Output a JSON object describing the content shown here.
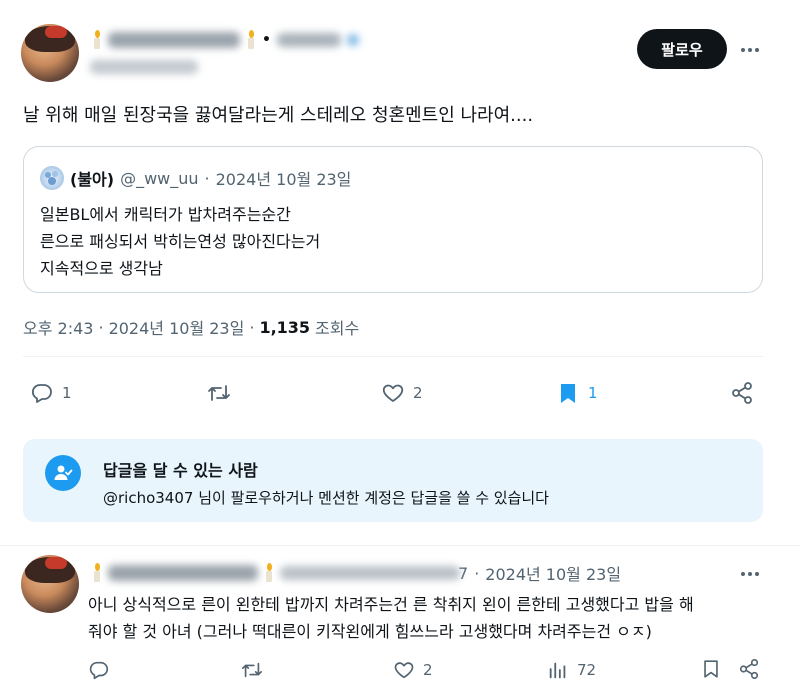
{
  "main_post": {
    "follow_label": "팔로우",
    "more_label": "···",
    "text": "날 위해 매일 된장국을 끓여달라는게 스테레오 청혼멘트인 나라여....",
    "quote": {
      "author_name": "(불아)",
      "author_handle": "@_ww_uu",
      "separator": "·",
      "date": "2024년 10월 23일",
      "lines": [
        "일본BL에서 캐릭터가 밥차려주는순간",
        "른으로 패싱되서 박히는연성 많아진다는거",
        "지속적으로 생각남"
      ]
    },
    "meta": {
      "time": "오후 2:43",
      "sep1": "·",
      "date": "2024년 10월 23일",
      "sep2": "·",
      "views_count": "1,135",
      "views_label": "조회수"
    },
    "actions": {
      "reply_count": "1",
      "retweet_count": "",
      "like_count": "2",
      "bookmark_count": "1"
    }
  },
  "reply_restriction": {
    "title": "답글을 달 수 있는 사람",
    "text": "@richo3407 님이 팔로우하거나 멘션한 계정은 답글을 쓸 수 있습니다"
  },
  "reply_post": {
    "handle_tail": "7",
    "separator": "·",
    "date": "2024년 10월 23일",
    "more_label": "···",
    "text_line1": "아니 상식적으로 른이 왼한테 밥까지 차려주는건 른 착취지 왼이 른한테 고생했다고 밥을 해",
    "text_line2": "줘야 할 것 아녀 (그러나 떡대른이 키작왼에게 힘쓰느라 고생했다며 차려주는건 ㅇㅈ)",
    "actions": {
      "reply_count": "",
      "retweet_count": "",
      "like_count": "2",
      "views_count": "72"
    }
  },
  "colors": {
    "accent": "#1d9bf0",
    "text": "#0f1419",
    "muted": "#536471",
    "border": "#cfd9de",
    "info_bg": "#e8f5fd"
  },
  "icons": [
    "reply-icon",
    "retweet-icon",
    "heart-icon",
    "bookmark-icon",
    "share-icon",
    "views-icon",
    "person-check-icon",
    "more-icon"
  ]
}
